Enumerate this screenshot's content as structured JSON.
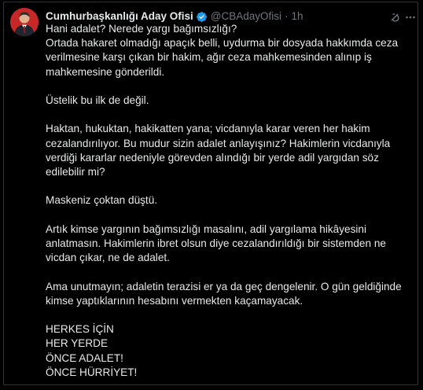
{
  "tweet": {
    "display_name": "Cumhurbaşkanlığı Aday Ofisi",
    "handle": "@CBAdayOfisi",
    "separator": "·",
    "time": "1h",
    "verified_color": "#1d9bf0",
    "paragraphs": [
      {
        "lines": [
          "Hani adalet? Nerede yargı bağımsızlığı?",
          "Ortada hakaret olmadığı apaçık belli, uydurma bir dosyada hakkımda ceza",
          "verilmesine karşı çıkan bir hakim, ağır ceza mahkemesinden alınıp iş",
          "mahkemesine gönderildi."
        ]
      },
      {
        "lines": [
          "Üstelik bu ilk de değil."
        ]
      },
      {
        "lines": [
          "Haktan, hukuktan, hakikatten yana; vicdanıyla karar veren her hakim",
          "cezalandırılıyor. Bu mudur sizin adalet anlayışınız? Hakimlerin vicdanıyla",
          "verdiği kararlar nedeniyle görevden alındığı bir yerde adil yargıdan söz",
          "edilebilir mi?"
        ]
      },
      {
        "lines": [
          "Maskeniz çoktan düştü."
        ]
      },
      {
        "lines": [
          "Artık kimse yargının bağımsızlığı masalını, adil yargılama hikâyesini",
          "anlatmasın. Hakimlerin ibret olsun diye cezalandırıldığı bir sistemden ne",
          "vicdan çıkar, ne de adalet."
        ]
      },
      {
        "lines": [
          "Ama unutmayın; adaletin terazisi er ya da geç dengelenir. O gün geldiğinde",
          "kimse yaptıklarının hesabını vermekten kaçamayacak."
        ]
      },
      {
        "lines": [
          "HERKES İÇİN",
          "HER YERDE",
          "ÖNCE ADALET!",
          "ÖNCE HÜRRİYET!"
        ]
      }
    ]
  }
}
